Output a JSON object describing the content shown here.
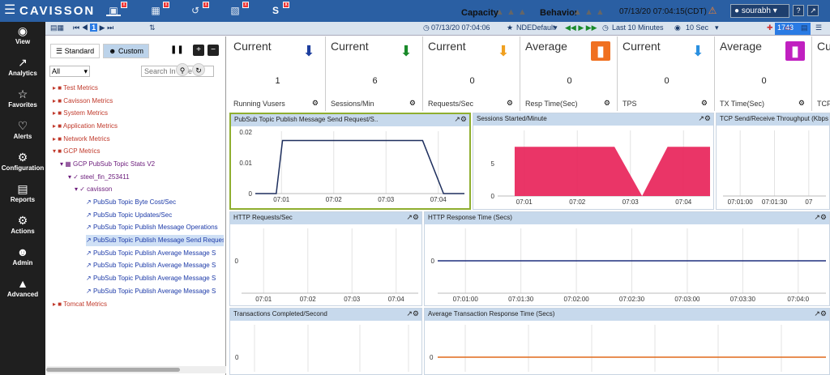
{
  "app": {
    "brand": "CAVISSON",
    "datetime": "07/13/20 07:04:15(CDT)",
    "user": "sourabh"
  },
  "top_labels": {
    "capacity": "Capacity",
    "behavior": "Behavior"
  },
  "nav": [
    {
      "label": "View",
      "icon": "eye-icon"
    },
    {
      "label": "Analytics",
      "icon": "chart-icon"
    },
    {
      "label": "Favorites",
      "icon": "star-icon"
    },
    {
      "label": "Alerts",
      "icon": "bell-icon"
    },
    {
      "label": "Configuration",
      "icon": "gears-icon"
    },
    {
      "label": "Reports",
      "icon": "document-icon"
    },
    {
      "label": "Actions",
      "icon": "actions-icon"
    },
    {
      "label": "Admin",
      "icon": "user-icon"
    },
    {
      "label": "Advanced",
      "icon": "advanced-icon"
    }
  ],
  "toolbar": {
    "time": "07/13/20 07:04:06",
    "favorite": "NDEDefault",
    "range": "Last 10 Minutes",
    "interval": "10 Sec",
    "live": "1743"
  },
  "tree": {
    "tab_standard": "Standard",
    "tab_custom": "Custom",
    "filter": "All",
    "search_placeholder": "Search In Tree",
    "items": [
      "Test Metrics",
      "Cavisson Metrics",
      "System Metrics",
      "Application Metrics",
      "Network Metrics",
      "GCP Metrics",
      "GCP PubSub Topic Stats V2",
      "steel_fin_253411",
      "cavisson",
      "PubSub Topic Byte Cost/Sec",
      "PubSub Topic Updates/Sec",
      "PubSub Topic Publish Message Operations",
      "PubSub Topic Publish Message Send Requests",
      "PubSub Topic Publish Average Message S",
      "PubSub Topic Publish Average Message S",
      "PubSub Topic Publish Average Message S",
      "PubSub Topic Publish Average Message S",
      "Tomcat Metrics"
    ]
  },
  "kpis": [
    {
      "title": "Current",
      "value": "1",
      "label": "Running Vusers",
      "color": "#1e3f9e",
      "icon": "down-arrow-icon"
    },
    {
      "title": "Current",
      "value": "6",
      "label": "Sessions/Min",
      "color": "#1a8a2a",
      "icon": "down-arrow-icon"
    },
    {
      "title": "Current",
      "value": "0",
      "label": "Requests/Sec",
      "color": "#f0a020",
      "icon": "down-arrow-icon"
    },
    {
      "title": "Average",
      "value": "0",
      "label": "Resp Time(Sec)",
      "color": "#f07020",
      "icon": "bar-chart-icon"
    },
    {
      "title": "Current",
      "value": "0",
      "label": "TPS",
      "color": "#2a90e0",
      "icon": "down-arrow-icon"
    },
    {
      "title": "Average",
      "value": "0",
      "label": "TX Time(Sec)",
      "color": "#c020c0",
      "icon": "bar-chart-icon"
    },
    {
      "title": "Cu",
      "value": "",
      "label": "TCP",
      "color": "#888888",
      "icon": ""
    }
  ],
  "panels": [
    {
      "title": "PubSub Topic Publish Message Send Request/S..",
      "yticks": [
        "0.02",
        "0.01",
        "0"
      ],
      "xticks": [
        "07:01",
        "07:02",
        "07:03",
        "07:04"
      ]
    },
    {
      "title": "Sessions Started/Minute",
      "yticks": [
        "5",
        "0"
      ],
      "xticks": [
        "07:01",
        "07:02",
        "07:03",
        "07:04"
      ]
    },
    {
      "title": "TCP Send/Receive Throughput (Kbps",
      "yticks": [],
      "xticks": [
        "07:01:00",
        "07:01:30",
        "07"
      ]
    },
    {
      "title": "HTTP Requests/Sec",
      "yticks": [
        "0"
      ],
      "xticks": [
        "07:01",
        "07:02",
        "07:03",
        "07:04"
      ]
    },
    {
      "title": "HTTP Response Time (Secs)",
      "yticks": [
        "0"
      ],
      "xticks": [
        "07:01:00",
        "07:01:30",
        "07:02:00",
        "07:02:30",
        "07:03:00",
        "07:03:30",
        "07:04:0"
      ]
    },
    {
      "title": "Transactions Completed/Second",
      "yticks": [
        "0"
      ],
      "xticks": []
    },
    {
      "title": "Average Transaction Response Time (Secs)",
      "yticks": [
        "0"
      ],
      "xticks": []
    }
  ],
  "chart_data": [
    {
      "type": "line",
      "title": "PubSub Topic Publish Message Send Request/S..",
      "x": [
        "07:00:50",
        "07:01:10",
        "07:01:20",
        "07:02:00",
        "07:02:30",
        "07:03:10",
        "07:03:20",
        "07:03:40",
        "07:04:00"
      ],
      "values": [
        0,
        0,
        0.017,
        0.017,
        0.017,
        0.017,
        0.017,
        0,
        0
      ],
      "ylim": [
        0,
        0.02
      ]
    },
    {
      "type": "area",
      "title": "Sessions Started/Minute",
      "x": [
        "07:01",
        "07:02",
        "07:02:45",
        "07:03",
        "07:04"
      ],
      "values": [
        6,
        6,
        0,
        6,
        6
      ],
      "ylim": [
        0,
        8
      ]
    },
    {
      "type": "line",
      "title": "HTTP Response Time (Secs)",
      "values": [
        0,
        0
      ],
      "ylim": [
        -1,
        1
      ]
    },
    {
      "type": "line",
      "title": "Average Transaction Response Time (Secs)",
      "values": [
        0,
        0
      ],
      "ylim": [
        -1,
        1
      ]
    }
  ]
}
